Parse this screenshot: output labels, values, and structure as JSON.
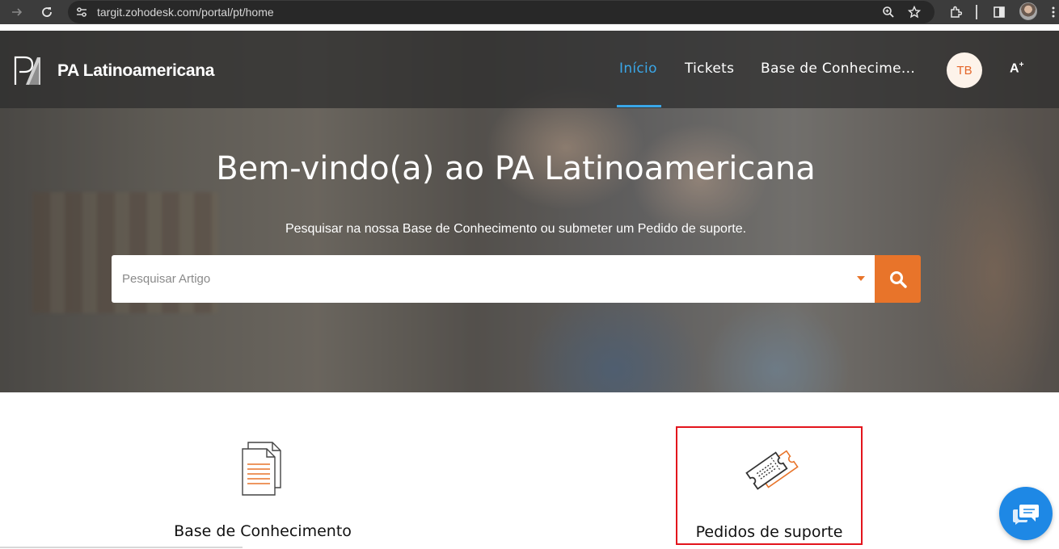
{
  "browser": {
    "url": "targit.zohodesk.com/portal/pt/home"
  },
  "header": {
    "brand": "PA Latinoamericana",
    "nav": [
      {
        "label": "Início",
        "active": true
      },
      {
        "label": "Tickets",
        "active": false
      },
      {
        "label": "Base de Conhecime...",
        "active": false
      }
    ],
    "avatar_initials": "TB",
    "accessibility_label": "A"
  },
  "hero": {
    "title": "Bem-vindo(a) ao PA Latinoamericana",
    "subtitle": "Pesquisar na nossa Base de Conhecimento ou submeter um Pedido de suporte.",
    "search_placeholder": "Pesquisar Artigo"
  },
  "cards": [
    {
      "label": "Base de Conhecimento",
      "icon": "documents-icon"
    },
    {
      "label": "Pedidos de suporte",
      "icon": "ticket-icon",
      "highlighted": true
    }
  ],
  "colors": {
    "accent": "#e8742a",
    "nav_active": "#3aa7e8",
    "highlight_border": "#e3141c",
    "chat": "#1e88e5"
  }
}
